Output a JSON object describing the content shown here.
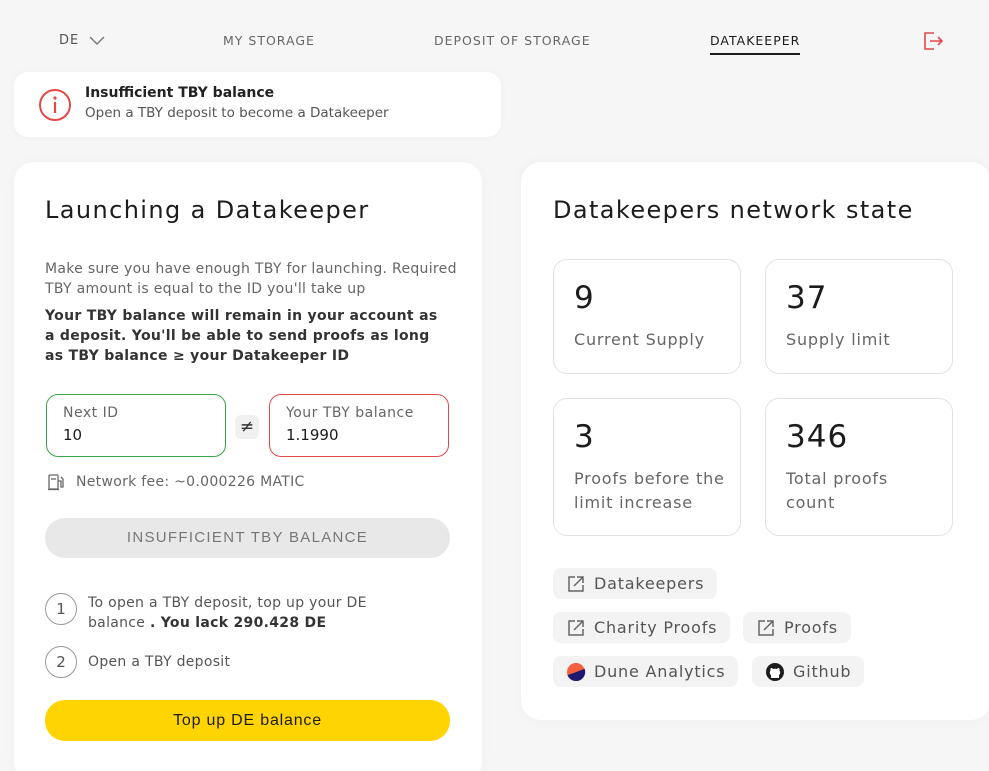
{
  "nav": {
    "language": "DE",
    "items": [
      "MY STORAGE",
      "DEPOSIT OF STORAGE",
      "DATAKEEPER"
    ],
    "active": "DATAKEEPER"
  },
  "alert": {
    "title": "Insufficient TBY balance",
    "message": "Open a TBY deposit to become a Datakeeper"
  },
  "launch": {
    "title": "Launching a Datakeeper",
    "note1": "Make sure you have enough TBY for launching. Required TBY amount is equal to the ID you'll take up",
    "note2": "Your TBY balance will remain in your account as a deposit. You'll be able to send proofs as long as TBY balance ≥ your Datakeeper ID",
    "next_id_label": "Next ID",
    "next_id_value": "10",
    "neq_symbol": "≠",
    "balance_label": "Your TBY balance",
    "balance_value": "1.1990",
    "fee": "Network fee: ~0.000226 MATIC",
    "disabled_button": "INSUFFICIENT TBY BALANCE",
    "steps": [
      {
        "num": "1",
        "text": "To open a TBY deposit, top up your DE balance",
        "strong": ". You lack 290.428 DE"
      },
      {
        "num": "2",
        "text": "Open a TBY deposit"
      }
    ],
    "topup_button": "Top up DE balance"
  },
  "network": {
    "title": "Datakeepers network state",
    "stats": [
      {
        "value": "9",
        "label": "Current Supply"
      },
      {
        "value": "37",
        "label": "Supply limit"
      },
      {
        "value": "3",
        "label": "Proofs before the limit increase"
      },
      {
        "value": "346",
        "label": "Total proofs count"
      }
    ],
    "links": [
      {
        "label": "Datakeepers",
        "icon": "external-link-icon"
      },
      {
        "label": "Charity Proofs",
        "icon": "external-link-icon"
      },
      {
        "label": "Proofs",
        "icon": "external-link-icon"
      },
      {
        "label": "Dune Analytics",
        "icon": "dune-logo-icon"
      },
      {
        "label": "Github",
        "icon": "github-icon"
      }
    ]
  },
  "colors": {
    "accent_yellow": "#ffd400",
    "ok_green": "#3aa54a",
    "error_red": "#e24a4a"
  }
}
